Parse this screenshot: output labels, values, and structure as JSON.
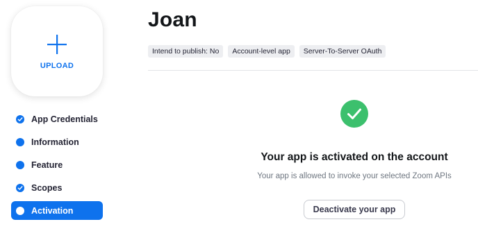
{
  "upload": {
    "label": "UPLOAD",
    "icon": "plus-icon"
  },
  "steps": [
    {
      "label": "App Credentials",
      "state": "completed",
      "icon": "check-icon"
    },
    {
      "label": "Information",
      "state": "current",
      "icon": "dot-icon"
    },
    {
      "label": "Feature",
      "state": "current",
      "icon": "dot-icon"
    },
    {
      "label": "Scopes",
      "state": "completed",
      "icon": "check-icon"
    },
    {
      "label": "Activation",
      "state": "active",
      "icon": "dot-icon"
    }
  ],
  "header": {
    "title": "Joan",
    "tags": [
      "Intend to publish: No",
      "Account-level app",
      "Server-To-Server OAuth"
    ]
  },
  "main": {
    "icon": "checkmark-circle-icon",
    "title": "Your app is activated on the account",
    "description": "Your app is allowed to invoke your selected Zoom APIs",
    "deactivate_label": "Deactivate your app"
  },
  "colors": {
    "accent": "#0e72ed",
    "success": "#3cc06d",
    "tag_bg": "#edeef1"
  }
}
